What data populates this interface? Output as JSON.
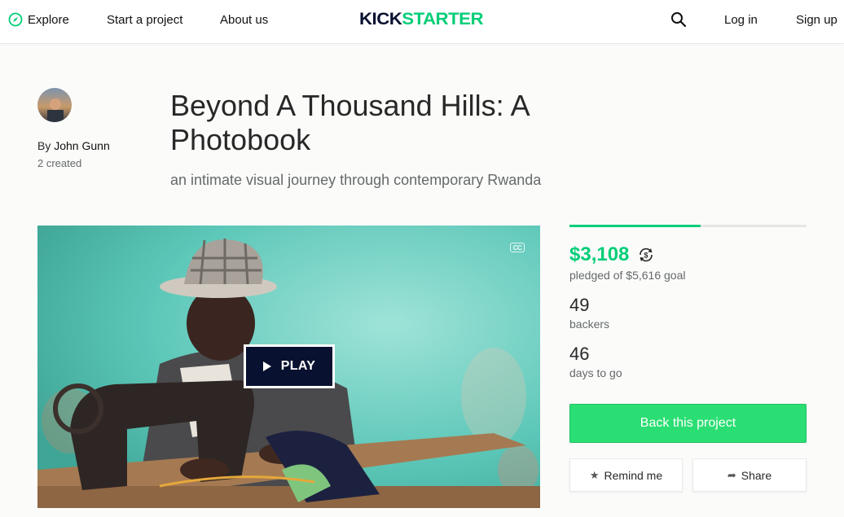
{
  "nav": {
    "explore": "Explore",
    "start": "Start a project",
    "about": "About us",
    "logo": "KICKSTARTER",
    "login": "Log in",
    "signup": "Sign up"
  },
  "creator": {
    "by": "By",
    "name": "John Gunn",
    "created": "2 created"
  },
  "project": {
    "title": "Beyond A Thousand Hills: A Photobook",
    "blurb": "an intimate visual journey through contemporary Rwanda",
    "cc_badge": "CC",
    "play_label": "PLAY"
  },
  "stats": {
    "pledged": "$3,108",
    "goal_text": "pledged of $5,616 goal",
    "progress_fraction": 0.553,
    "backers": "49",
    "backers_label": "backers",
    "days": "46",
    "days_label": "days to go"
  },
  "actions": {
    "back": "Back this project",
    "remind": "Remind me",
    "share": "Share"
  },
  "icons": {
    "explore": "compass-icon",
    "search": "search-icon",
    "currency": "currency-conversion-icon",
    "remind": "star-icon",
    "share": "share-arrow-icon"
  },
  "colors": {
    "brand_green": "#05ce78",
    "button_green": "#2bde73",
    "logo_dark": "#081130",
    "play_bg": "#081130"
  }
}
